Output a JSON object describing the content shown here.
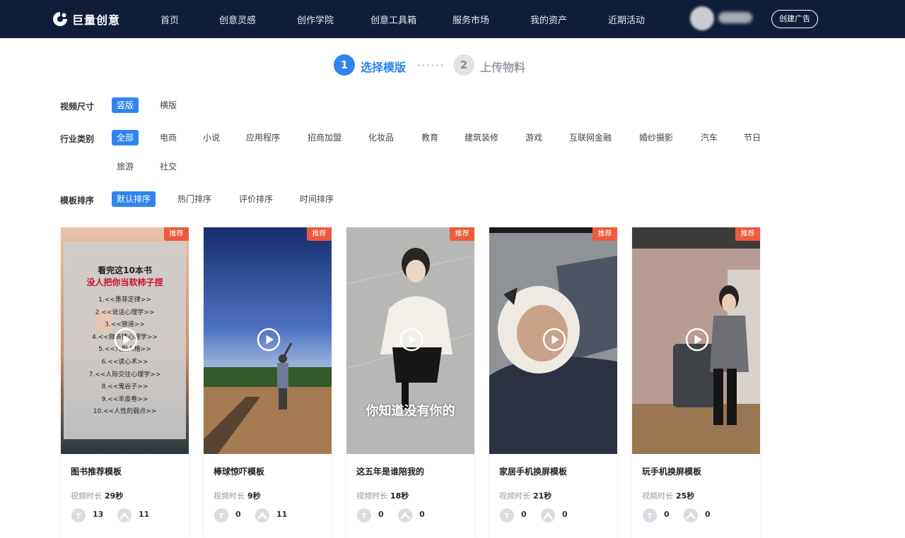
{
  "header": {
    "brand": "巨量创意",
    "nav": [
      "首页",
      "创意灵感",
      "创作学院",
      "创意工具箱",
      "服务市场",
      "我的资产",
      "近期活动"
    ],
    "create_button": "创建广告"
  },
  "steps": [
    {
      "num": "1",
      "label": "选择模版"
    },
    {
      "num": "2",
      "label": "上传物料"
    }
  ],
  "filters": {
    "size": {
      "label": "视频尺寸",
      "options": [
        "竖版",
        "横版"
      ]
    },
    "industry": {
      "label": "行业类别",
      "options": [
        "全部",
        "电商",
        "小说",
        "应用程序",
        "招商加盟",
        "化妆品",
        "教育",
        "建筑装修",
        "游戏",
        "互联网金融",
        "婚纱摄影",
        "汽车",
        "节日",
        "旅游",
        "社交"
      ]
    },
    "sort": {
      "label": "模板排序",
      "options": [
        "默认排序",
        "热门排序",
        "评价排序",
        "时间排序"
      ]
    }
  },
  "cards": [
    {
      "badge": "推荐",
      "title": "图书推荐模板",
      "duration_label": "视频时长",
      "duration": "29秒",
      "stat1": "13",
      "stat2": "11",
      "overlay_line1": "看完这10本书",
      "overlay_line2": "没人把你当软柿子捏",
      "overlay_list": [
        "1.<<墨菲定律>>",
        "2.<<说话心理学>>",
        "3.<<狼道>>",
        "4.<<微表情心理学>>",
        "5.<<九型人格>>",
        "6.<<读心术>>",
        "7.<<人际交往心理学>>",
        "8.<<鬼谷子>>",
        "9.<<羊皮卷>>",
        "10.<<人性的弱点>>"
      ]
    },
    {
      "badge": "推荐",
      "title": "棒球惊吓模板",
      "duration_label": "视频时长",
      "duration": "9秒",
      "stat1": "0",
      "stat2": "11"
    },
    {
      "badge": "推荐",
      "title": "这五年是谁陪我的",
      "duration_label": "视频时长",
      "duration": "18秒",
      "stat1": "0",
      "stat2": "0",
      "overlay_caption": "你知道没有你的"
    },
    {
      "badge": "推荐",
      "title": "家居手机换屏模板",
      "duration_label": "视频时长",
      "duration": "21秒",
      "stat1": "0",
      "stat2": "0"
    },
    {
      "badge": "推荐",
      "title": "玩手机换屏模板",
      "duration_label": "视频时长",
      "duration": "25秒",
      "stat1": "0",
      "stat2": "0"
    }
  ],
  "colors": {
    "nav_bg": "#0f1d38",
    "accent": "#2f84f0",
    "badge": "#ee5a3b"
  }
}
